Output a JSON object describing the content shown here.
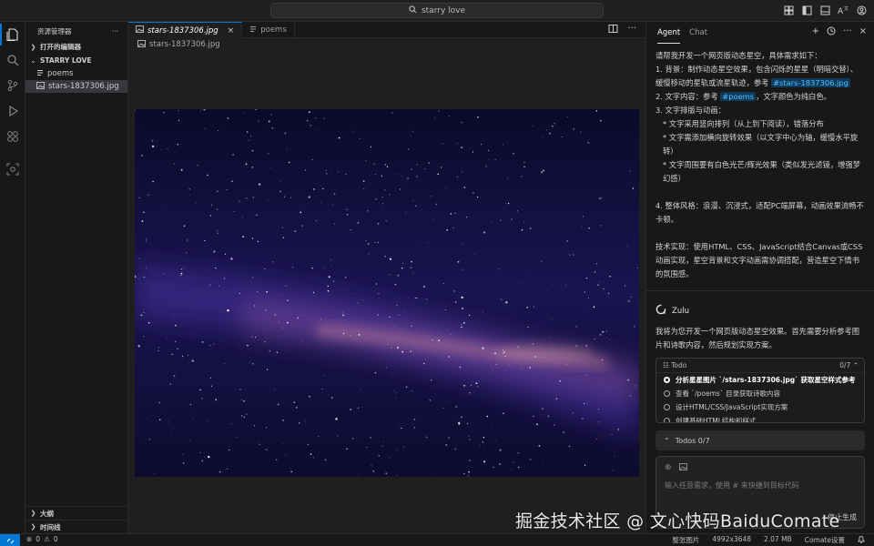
{
  "titlebar": {
    "search_text": "starry love"
  },
  "sidebar": {
    "title": "资源管理器",
    "more": "···",
    "open_editors": "打开的编辑器",
    "folder": "STARRY LOVE",
    "items": [
      {
        "label": "poems",
        "icon": "file-lines-icon"
      },
      {
        "label": "stars-1837306.jpg",
        "icon": "image-file-icon",
        "selected": true
      }
    ],
    "outline": "大纲",
    "timeline": "时间线"
  },
  "editor": {
    "tabs": [
      {
        "label": "stars-1837306.jpg",
        "active": true,
        "close": "×"
      },
      {
        "label": "poems",
        "active": false
      }
    ],
    "breadcrumb": "stars-1837306.jpg"
  },
  "agent": {
    "tabs": [
      "Agent",
      "Chat"
    ],
    "prompt": {
      "l1": "请帮我开发一个网页版动态星空，具体需求如下：",
      "l2": "1. 背景：制作动态星空效果，包含闪烁的星星（明暗交替）、缓慢移动的星轨或流星轨迹，参考",
      "chip1": "#stars-1837306.jpg",
      "l3a": "2. 文字内容：参考",
      "chip2": "#poems",
      "l3b": "，文字颜色为纯白色。",
      "l4": "3. 文字排版与动画：",
      "l5": "* 文字采用竖向排列（从上到下阅读），错落分布",
      "l6": "* 文字需添加横向旋转效果（以文字中心为轴，缓慢水平旋转）",
      "l7": "* 文字周围要有白色光芒/辉光效果（类似发光滤镜，增强梦幻感）",
      "l8": "4. 整体风格：浪漫、沉浸式，适配PC端屏幕，动画效果流畅不卡顿。",
      "l9": "技术实现：使用HTML、CSS、JavaScript结合Canvas或CSS动画实现，星空背景和文字动画需协调搭配，营造星空下情书的氛围感。"
    },
    "assistant_name": "Zulu",
    "reply": "我将为您开发一个网页版动态星空效果。首先需要分析参考图片和诗歌内容，然后规划实现方案。",
    "todo": {
      "title": "Todo",
      "count": "0/7",
      "items": [
        "分析星星图片 `/stars-1837306.jpg` 获取星空样式参考",
        "查看 `/poems` 目录获取诗歌内容",
        "设计HTML/CSS/JavaScript实现方案",
        "创建基础HTML结构和样式"
      ]
    },
    "todos_bar": "Todos 0/7",
    "input_placeholder": "输入任意需求，使用 # 来快捷到目标代码",
    "stop_label": "停止生成"
  },
  "watermark": "掘金技术社区 @ 文心快码BaiduComate",
  "statusbar": {
    "errors": "0",
    "warnings": "0",
    "whole_image": "整张图片",
    "dimensions": "4992x3648",
    "size": "2.07 MB",
    "comate": "Comate设置"
  },
  "colors": {
    "accent": "#0078d4",
    "chip_bg": "#0e3a5c",
    "chip_text": "#4fc1ff"
  }
}
